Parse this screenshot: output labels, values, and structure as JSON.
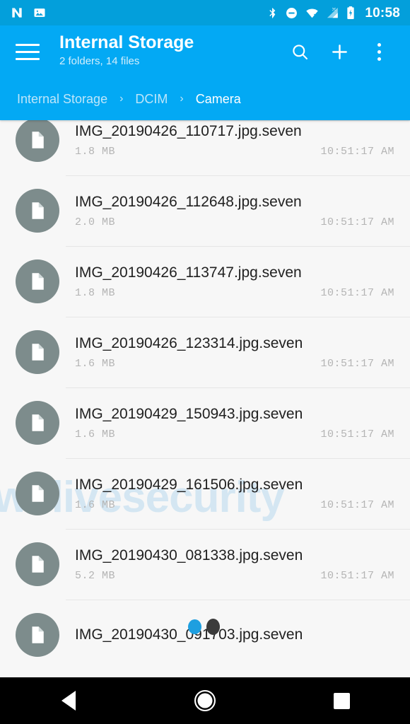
{
  "status_bar": {
    "left_icons": [
      "nougat-n-icon",
      "photo-icon"
    ],
    "right_icons": [
      "bluetooth-icon",
      "do-not-disturb-icon",
      "wifi-off-icon",
      "cellular-off-icon",
      "battery-charging-icon"
    ],
    "time": "10:58",
    "background_color": "#039fdb"
  },
  "toolbar": {
    "menu_icon": "hamburger-menu-icon",
    "title": "Internal Storage",
    "subtitle": "2 folders, 14 files",
    "actions": [
      "search-icon",
      "add-icon",
      "overflow-menu-icon"
    ],
    "background_color": "#03a9f4"
  },
  "breadcrumb": {
    "separator": "›",
    "items": [
      {
        "label": "Internal Storage",
        "active": false
      },
      {
        "label": "DCIM",
        "active": false
      },
      {
        "label": "Camera",
        "active": true
      }
    ]
  },
  "watermark": {
    "text": "welivesecurity",
    "color": "#cfe4f2"
  },
  "file_list": {
    "icon_color": "#7d8c8c",
    "file_icon": "document-file-icon",
    "rows": [
      {
        "name": "IMG_20190426_110717.jpg.seven",
        "size": "1.8 MB",
        "time": "10:51:17 AM"
      },
      {
        "name": "IMG_20190426_112648.jpg.seven",
        "size": "2.0 MB",
        "time": "10:51:17 AM"
      },
      {
        "name": "IMG_20190426_113747.jpg.seven",
        "size": "1.8 MB",
        "time": "10:51:17 AM"
      },
      {
        "name": "IMG_20190426_123314.jpg.seven",
        "size": "1.6 MB",
        "time": "10:51:17 AM"
      },
      {
        "name": "IMG_20190429_150943.jpg.seven",
        "size": "1.6 MB",
        "time": "10:51:17 AM"
      },
      {
        "name": "IMG_20190429_161506.jpg.seven",
        "size": "1.6 MB",
        "time": "10:51:17 AM"
      },
      {
        "name": "IMG_20190430_081338.jpg.seven",
        "size": "5.2 MB",
        "time": "10:51:17 AM"
      },
      {
        "name": "IMG_20190430_091703.jpg.seven",
        "size": "",
        "time": ""
      }
    ]
  },
  "touch_indicator": {
    "blue_color": "#1e9fe0",
    "dark_color": "#3b3b3b"
  },
  "nav_bar": {
    "buttons": [
      "back-button",
      "home-button",
      "recents-button"
    ],
    "background_color": "#000000"
  }
}
